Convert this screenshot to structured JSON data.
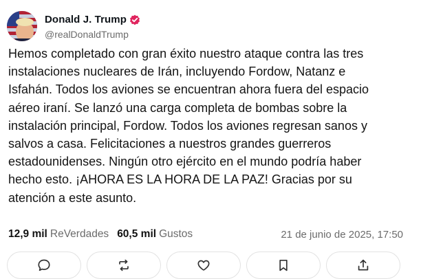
{
  "post": {
    "author": {
      "display_name": "Donald J. Trump",
      "handle": "@realDonaldTrump",
      "verified": true,
      "verified_color": "#e0245e"
    },
    "text": "Hemos completado con gran éxito nuestro ataque contra las tres\ninstalaciones nucleares de Irán, incluyendo Fordow, Natanz e\nIsfahán. Todos los aviones se encuentran ahora fuera del espacio\naéreo iraní. Se lanzó una carga completa de bombas sobre la\ninstalación principal, Fordow. Todos los aviones regresan sanos y\nsalvos a casa. Felicitaciones a nuestros grandes guerreros\nestadounidenses. Ningún otro ejército en el mundo podría haber\nhecho esto. ¡AHORA ES LA HORA DE LA PAZ! Gracias por su\natención a este asunto.",
    "stats": {
      "reposts_count": "12,9 mil",
      "reposts_label": "ReVerdades",
      "likes_count": "60,5 mil",
      "likes_label": "Gustos"
    },
    "timestamp": "21 de junio de 2025, 17:50",
    "actions": [
      {
        "name": "reply",
        "icon": "speech-bubble-icon"
      },
      {
        "name": "repost",
        "icon": "repost-arrows-icon"
      },
      {
        "name": "like",
        "icon": "heart-icon"
      },
      {
        "name": "bookmark",
        "icon": "bookmark-icon"
      },
      {
        "name": "share",
        "icon": "share-upload-icon"
      }
    ]
  }
}
